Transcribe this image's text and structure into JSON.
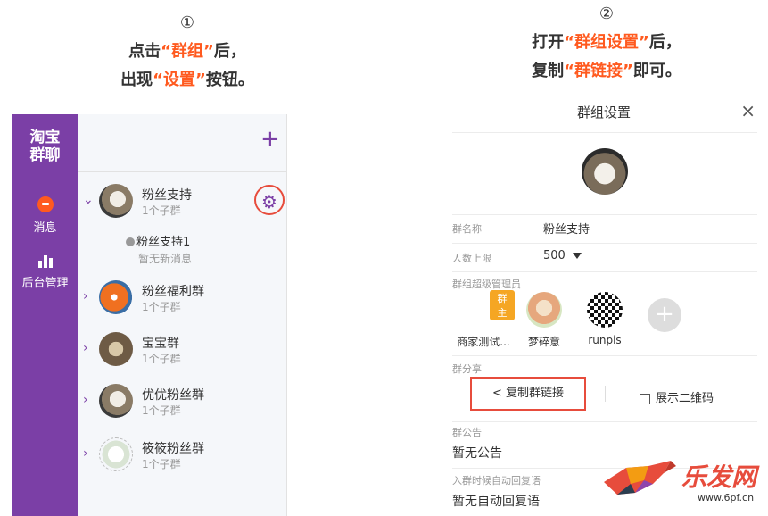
{
  "step1": {
    "number": "①",
    "line1_pre": "点击",
    "line1_hl": "“群组”",
    "line1_post": "后，",
    "line2_pre": "出现",
    "line2_hl": "“设置”",
    "line2_post": "按钮。"
  },
  "step2": {
    "number": "②",
    "line1_pre": "打开",
    "line1_hl": "“群组设置”",
    "line1_post": "后，",
    "line2_pre": "复制",
    "line2_hl": "“群链接”",
    "line2_post": "即可。"
  },
  "sidebar": {
    "brand_line1": "淘宝",
    "brand_line2": "群聊",
    "nav_messages": "消息",
    "nav_admin": "后台管理"
  },
  "list": {
    "add_icon": "plus-icon",
    "groups": [
      {
        "name": "粉丝支持",
        "sub": "1个子群",
        "expanded": true
      },
      {
        "name": "粉丝福利群",
        "sub": "1个子群"
      },
      {
        "name": "宝宝群",
        "sub": "1个子群"
      },
      {
        "name": "优优粉丝群",
        "sub": "1个子群"
      },
      {
        "name": "筱筱粉丝群",
        "sub": "1个子群"
      }
    ],
    "subgroup": {
      "name": "粉丝支持1",
      "status": "暂无新消息"
    }
  },
  "settings": {
    "title": "群组设置",
    "close": "×",
    "group_name_label": "群名称",
    "group_name": "粉丝支持",
    "limit_label": "人数上限",
    "limit_value": "500",
    "admins_label": "群组超级管理员",
    "owner_badge": "群主",
    "admins": [
      "商家测试...",
      "梦碎意",
      "runpis"
    ],
    "add_admin": "+",
    "share_label": "群分享",
    "copy_link": "复制群链接",
    "show_qr": "展示二维码",
    "notice_label": "群公告",
    "notice_value": "暂无公告",
    "autoreply_label": "入群时候自动回复语",
    "autoreply_value": "暂无自动回复语"
  },
  "watermark": {
    "text": "乐发网",
    "url": "www.6pf.cn"
  },
  "colors": {
    "purple": "#7b3fa6",
    "highlight": "#ff5a1f",
    "red_ring": "#e74c3c"
  }
}
